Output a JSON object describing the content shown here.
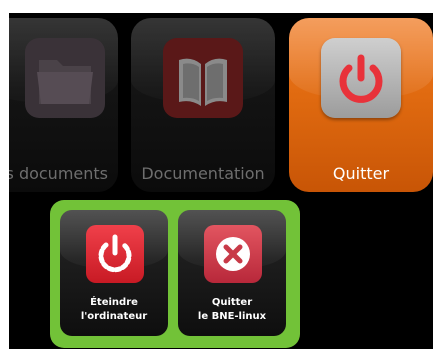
{
  "tiles": {
    "documents": {
      "label": "s documents",
      "icon": "folder-icon"
    },
    "documentation": {
      "label": "Documentation",
      "icon": "book-icon"
    },
    "quit": {
      "label": "Quitter",
      "icon": "power-icon"
    }
  },
  "submenu": {
    "shutdown": {
      "line1": "Éteindre",
      "line2": "l'ordinateur",
      "icon": "power-icon"
    },
    "quit_bne": {
      "line1": "Quitter",
      "line2": "le BNE-linux",
      "icon": "close-icon"
    }
  },
  "colors": {
    "quit_tile": "#e06a10",
    "submenu_background": "#72c238",
    "shutdown_icon": "#e02a34",
    "quit_bne_icon": "#c83a48"
  }
}
